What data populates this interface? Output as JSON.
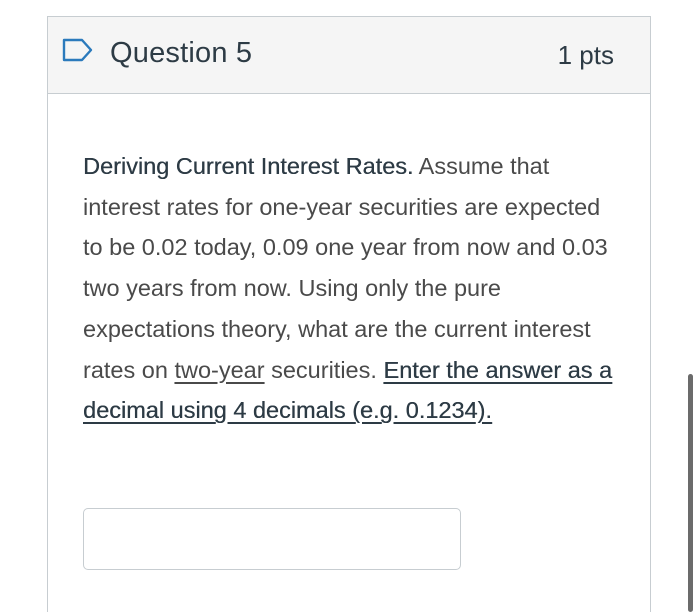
{
  "header": {
    "title": "Question 5",
    "points": "1 pts",
    "flag_icon": "flag-outline-icon",
    "flag_color": "#2b7abc"
  },
  "question": {
    "heading": "Deriving Current Interest Rates.",
    "text_1": " Assume that interest rates for one-year securities are expected to be 0.02 today, 0.09 one year from now and 0.03 two years from now. Using only the pure expectations theory, what are the current interest rates on ",
    "emphasis_term": "two-year",
    "text_2": " securities. ",
    "instruction": "Enter the answer as a decimal using 4 decimals (e.g. 0.1234)."
  },
  "answer": {
    "value": "",
    "placeholder": ""
  }
}
